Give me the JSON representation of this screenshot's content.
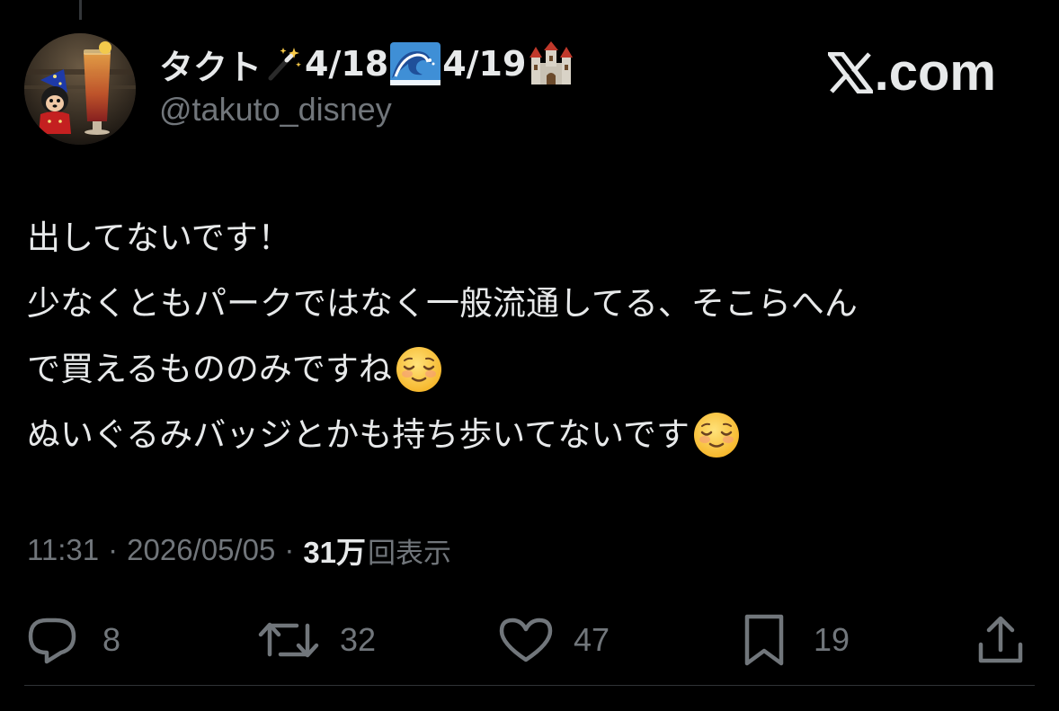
{
  "author": {
    "display_name_parts": [
      "タクト",
      "4/18",
      "4/19"
    ],
    "display_name_emojis": [
      "magic-wand-emoji",
      "wave-emoji",
      "castle-emoji"
    ],
    "handle": "@takuto_disney"
  },
  "brand": {
    "text": ".com",
    "logo": "x-logo"
  },
  "tweet": {
    "lines": [
      "出してないです！",
      "少なくともパークではなく一般流通してる、そこらへん",
      "で買えるもののみですね",
      "ぬいぐるみバッジとかも持ち歩いてないです"
    ],
    "line_emojis": [
      "",
      "",
      "relieved-face-emoji",
      "relieved-face-emoji"
    ]
  },
  "meta": {
    "time": "11:31",
    "separator": "·",
    "date": "2026/05/05",
    "views_count": "31万",
    "views_label": "回表示"
  },
  "actions": {
    "reply": {
      "icon": "reply-icon",
      "count": "8"
    },
    "repost": {
      "icon": "repost-icon",
      "count": "32"
    },
    "like": {
      "icon": "heart-icon",
      "count": "47"
    },
    "bookmark": {
      "icon": "bookmark-icon",
      "count": "19"
    },
    "share": {
      "icon": "share-icon"
    }
  },
  "colors": {
    "background": "#000000",
    "primary_text": "#e7e9ea",
    "secondary_text": "#71767b",
    "divider": "#2f3336"
  }
}
